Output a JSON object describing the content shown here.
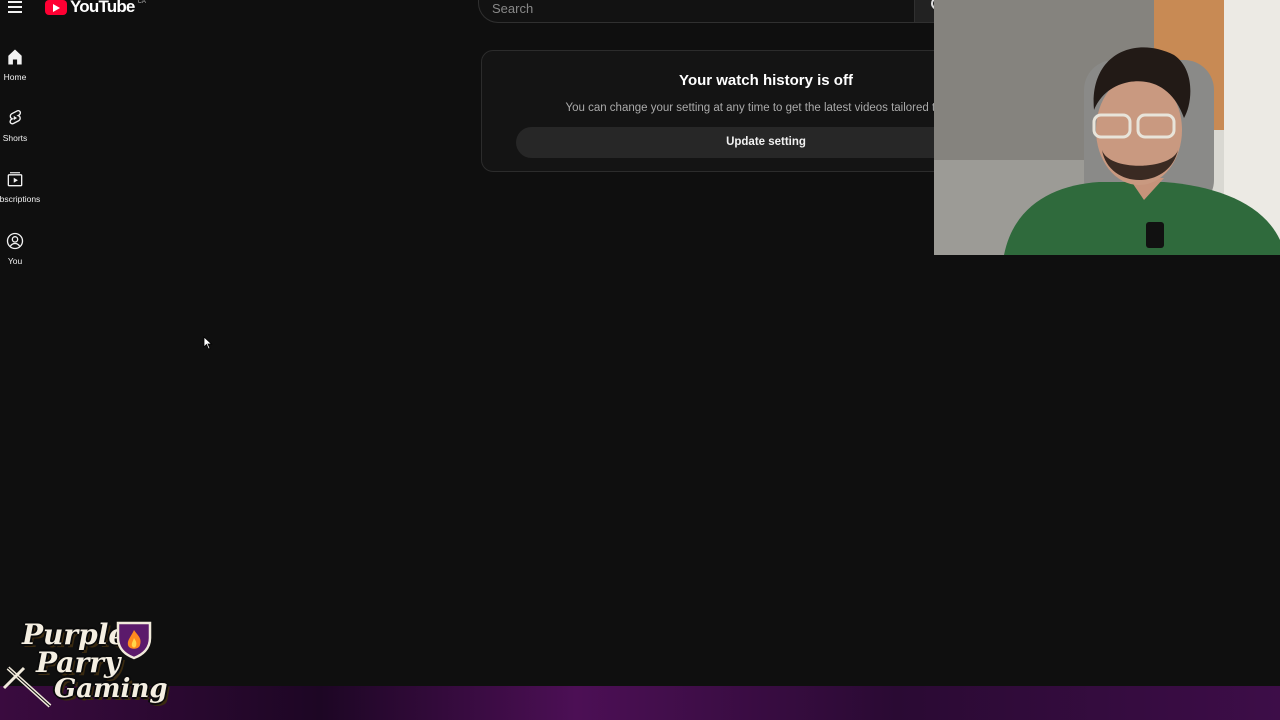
{
  "header": {
    "logo_text": "YouTube",
    "logo_region": "CA",
    "search_placeholder": "Search"
  },
  "sidebar": {
    "items": [
      {
        "label": "Home",
        "icon": "home-icon"
      },
      {
        "label": "Shorts",
        "icon": "shorts-icon"
      },
      {
        "label": "bscriptions",
        "icon": "subscriptions-icon"
      },
      {
        "label": "You",
        "icon": "account-icon"
      }
    ]
  },
  "history_panel": {
    "title": "Your watch history is off",
    "description": "You can change your setting at any time to get the latest videos tailored to you.",
    "button_label": "Update setting"
  },
  "overlay": {
    "stream_logo_lines": [
      "Purple",
      "Parry",
      "Gaming"
    ]
  },
  "colors": {
    "background": "#0f0f0f",
    "brand_red": "#ff0033",
    "button_bg": "#272727",
    "stream_bar": "#3a0b3f"
  }
}
